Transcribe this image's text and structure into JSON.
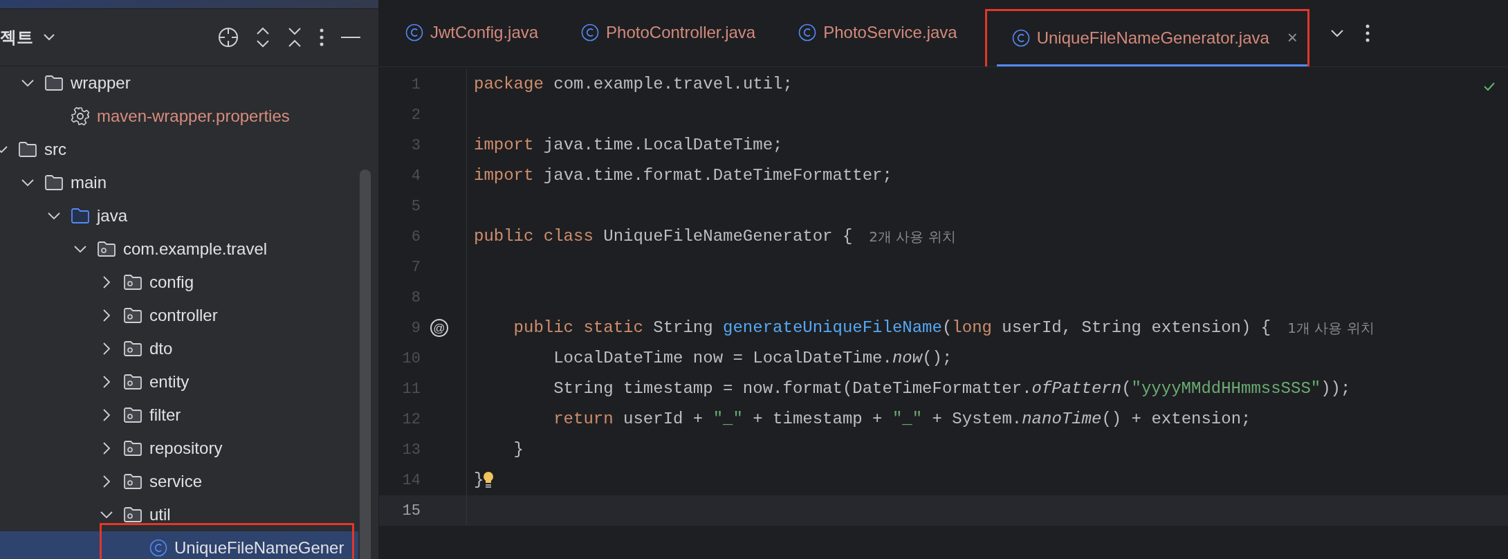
{
  "project_panel": {
    "title": "젝트",
    "tree": {
      "continuation": [
        {
          "label": "wrapper",
          "kind": "folder",
          "expanded": true,
          "selected": false,
          "highlighted": false,
          "color": "#dfe1e5",
          "children": [
            {
              "label": "maven-wrapper.properties",
              "kind": "settings_file",
              "selected": false,
              "highlighted": false,
              "color": "#d98c7e"
            }
          ]
        }
      ],
      "roots": [
        {
          "label": "src",
          "kind": "folder",
          "expanded": true,
          "selected": false,
          "highlighted": false,
          "color": "#dfe1e5",
          "children": [
            {
              "label": "main",
              "kind": "folder",
              "expanded": true,
              "selected": false,
              "highlighted": false,
              "color": "#dfe1e5",
              "children": [
                {
                  "label": "java",
                  "kind": "source_root",
                  "expanded": true,
                  "selected": false,
                  "highlighted": false,
                  "color": "#dfe1e5",
                  "children": [
                    {
                      "label": "com.example.travel",
                      "kind": "package",
                      "expanded": true,
                      "selected": false,
                      "highlighted": false,
                      "color": "#dfe1e5",
                      "children": [
                        {
                          "label": "config",
                          "kind": "package",
                          "expanded": false,
                          "selected": false,
                          "highlighted": false,
                          "color": "#dfe1e5"
                        },
                        {
                          "label": "controller",
                          "kind": "package",
                          "expanded": false,
                          "selected": false,
                          "highlighted": false,
                          "color": "#dfe1e5"
                        },
                        {
                          "label": "dto",
                          "kind": "package",
                          "expanded": false,
                          "selected": false,
                          "highlighted": false,
                          "color": "#dfe1e5"
                        },
                        {
                          "label": "entity",
                          "kind": "package",
                          "expanded": false,
                          "selected": false,
                          "highlighted": false,
                          "color": "#dfe1e5"
                        },
                        {
                          "label": "filter",
                          "kind": "package",
                          "expanded": false,
                          "selected": false,
                          "highlighted": false,
                          "color": "#dfe1e5"
                        },
                        {
                          "label": "repository",
                          "kind": "package",
                          "expanded": false,
                          "selected": false,
                          "highlighted": false,
                          "color": "#dfe1e5"
                        },
                        {
                          "label": "service",
                          "kind": "package",
                          "expanded": false,
                          "selected": false,
                          "highlighted": false,
                          "color": "#dfe1e5"
                        },
                        {
                          "label": "util",
                          "kind": "package",
                          "expanded": true,
                          "selected": false,
                          "highlighted": false,
                          "color": "#dfe1e5",
                          "children": [
                            {
                              "label": "UniqueFileNameGener",
                              "kind": "class",
                              "selected": true,
                              "highlighted": true,
                              "color": "#dfe1e5"
                            }
                          ]
                        }
                      ]
                    }
                  ]
                }
              ]
            }
          ]
        }
      ]
    }
  },
  "editor": {
    "tabs": [
      {
        "label": "JwtConfig.java",
        "selected": false,
        "highlighted": false,
        "closable": false
      },
      {
        "label": "PhotoController.java",
        "selected": false,
        "highlighted": false,
        "closable": false
      },
      {
        "label": "PhotoService.java",
        "selected": false,
        "highlighted": false,
        "closable": false
      },
      {
        "label": "UniqueFileNameGenerator.java",
        "selected": true,
        "highlighted": true,
        "closable": true
      }
    ],
    "close_glyph": "×",
    "lines": [
      {
        "number": "1",
        "current": false,
        "bulb": false,
        "tokens": [
          {
            "kind": "keyword",
            "text": "package"
          },
          {
            "kind": "plain",
            "text": " com.example.travel.util;"
          }
        ]
      },
      {
        "number": "2",
        "current": false,
        "bulb": false
      },
      {
        "number": "3",
        "current": false,
        "bulb": false,
        "tokens": [
          {
            "kind": "keyword",
            "text": "import"
          },
          {
            "kind": "plain",
            "text": " java.time.LocalDateTime;"
          }
        ]
      },
      {
        "number": "4",
        "current": false,
        "bulb": false,
        "tokens": [
          {
            "kind": "keyword",
            "text": "import"
          },
          {
            "kind": "plain",
            "text": " java.time.format.DateTimeFormatter;"
          }
        ]
      },
      {
        "number": "5",
        "current": false,
        "bulb": false
      },
      {
        "number": "6",
        "current": false,
        "bulb": false,
        "tokens": [
          {
            "kind": "keyword",
            "text": "public class"
          },
          {
            "kind": "plain",
            "text": " UniqueFileNameGenerator {"
          },
          {
            "kind": "hint",
            "text": "2개 사용 위치"
          }
        ]
      },
      {
        "number": "7",
        "current": false,
        "bulb": false
      },
      {
        "number": "8",
        "current": false,
        "bulb": false
      },
      {
        "number": "9",
        "current": false,
        "gutter_mark": "@",
        "bulb": false,
        "tokens": [
          {
            "kind": "keyword",
            "text": "    public static"
          },
          {
            "kind": "plain",
            "text": " String "
          },
          {
            "kind": "method",
            "text": "generateUniqueFileName"
          },
          {
            "kind": "plain",
            "text": "("
          },
          {
            "kind": "keyword",
            "text": "long"
          },
          {
            "kind": "plain",
            "text": " userId, String extension) {"
          },
          {
            "kind": "hint",
            "text": "1개 사용 위치"
          }
        ]
      },
      {
        "number": "10",
        "current": false,
        "bulb": false,
        "tokens": [
          {
            "kind": "plain",
            "text": "        LocalDateTime now = LocalDateTime."
          },
          {
            "kind": "static_call",
            "text": "now"
          },
          {
            "kind": "plain",
            "text": "();"
          }
        ]
      },
      {
        "number": "11",
        "current": false,
        "bulb": false,
        "tokens": [
          {
            "kind": "plain",
            "text": "        String timestamp = now.format(DateTimeFormatter."
          },
          {
            "kind": "static_call",
            "text": "ofPattern"
          },
          {
            "kind": "plain",
            "text": "("
          },
          {
            "kind": "string",
            "text": "\"yyyyMMddHHmmssSSS\""
          },
          {
            "kind": "plain",
            "text": "));"
          }
        ]
      },
      {
        "number": "12",
        "current": false,
        "bulb": false,
        "tokens": [
          {
            "kind": "keyword",
            "text": "        return"
          },
          {
            "kind": "plain",
            "text": " userId + "
          },
          {
            "kind": "string",
            "text": "\"_\""
          },
          {
            "kind": "plain",
            "text": " + timestamp + "
          },
          {
            "kind": "string",
            "text": "\"_\""
          },
          {
            "kind": "plain",
            "text": " + System."
          },
          {
            "kind": "static_call",
            "text": "nanoTime"
          },
          {
            "kind": "plain",
            "text": "() + extension;"
          }
        ]
      },
      {
        "number": "13",
        "current": false,
        "bulb": false,
        "tokens": [
          {
            "kind": "plain",
            "text": "    }"
          }
        ]
      },
      {
        "number": "14",
        "current": false,
        "bulb": true,
        "tokens": [
          {
            "kind": "plain",
            "text": "}"
          }
        ]
      },
      {
        "number": "15",
        "current": true,
        "bulb": false
      }
    ]
  }
}
